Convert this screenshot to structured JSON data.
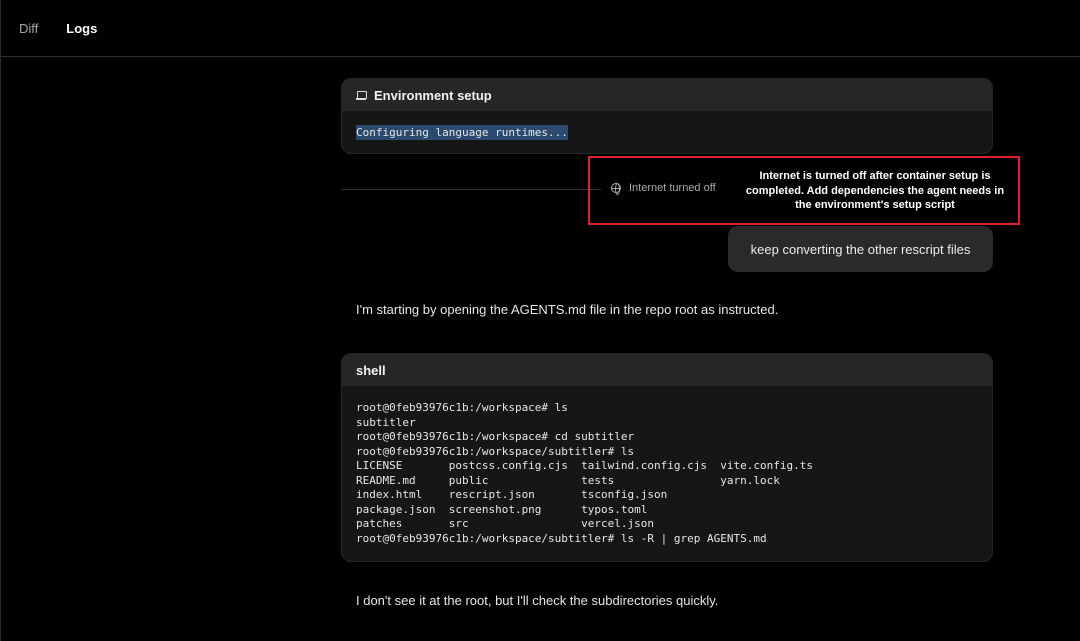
{
  "tabs": [
    {
      "label": "Diff",
      "active": false
    },
    {
      "label": "Logs",
      "active": true
    }
  ],
  "env_card": {
    "title": "Environment setup",
    "icon": "laptop-icon",
    "output": "Configuring language runtimes..."
  },
  "internet": {
    "status": "Internet turned off",
    "icon": "globe-icon",
    "tooltip": "Internet is turned off after container setup is completed. Add dependencies the agent needs in the environment's setup script"
  },
  "user_message": "keep converting the other rescript files",
  "messages": [
    "I'm starting by opening the AGENTS.md file in the repo root as instructed.",
    "I don't see it at the root, but I'll check the subdirectories quickly."
  ],
  "shell_card": {
    "title": "shell",
    "output": "root@0feb93976c1b:/workspace# ls\nsubtitler\nroot@0feb93976c1b:/workspace# cd subtitler\nroot@0feb93976c1b:/workspace/subtitler# ls\nLICENSE       postcss.config.cjs  tailwind.config.cjs  vite.config.ts\nREADME.md     public              tests                yarn.lock\nindex.html    rescript.json       tsconfig.json\npackage.json  screenshot.png      typos.toml\npatches       src                 vercel.json\nroot@0feb93976c1b:/workspace/subtitler# ls -R | grep AGENTS.md"
  },
  "colors": {
    "background": "#000000",
    "card": "#161616",
    "card_header": "#262626",
    "highlight": "#2c4a6e",
    "annotation_border": "#e0202a"
  }
}
